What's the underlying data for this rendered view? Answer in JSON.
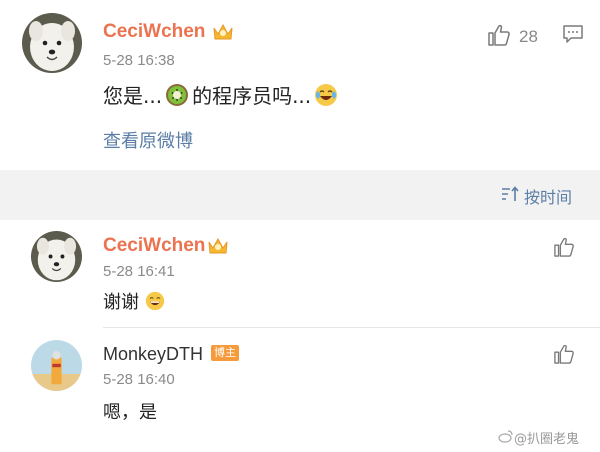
{
  "post": {
    "username": "CeciWchen",
    "time": "5-28 16:38",
    "text_before": "您是...",
    "text_after": "的程序员吗...",
    "view_original": "查看原微博",
    "like_count": "28"
  },
  "sort": {
    "label": "按时间"
  },
  "comments": [
    {
      "username": "CeciWchen",
      "time": "5-28 16:41",
      "text": "谢谢"
    },
    {
      "username": "MonkeyDTH",
      "badge": "博主",
      "time": "5-28 16:40",
      "text": "嗯，是"
    }
  ],
  "watermark": "@扒圈老鬼",
  "colors": {
    "username": "#eb7350",
    "link": "#5a7ea6",
    "badge": "#f59b3c"
  },
  "icons": [
    "crown-icon",
    "kiwi-emoji-icon",
    "laugh-cry-emoji-icon",
    "thumbs-up-icon",
    "comment-icon",
    "sort-icon",
    "grin-emoji-icon"
  ]
}
